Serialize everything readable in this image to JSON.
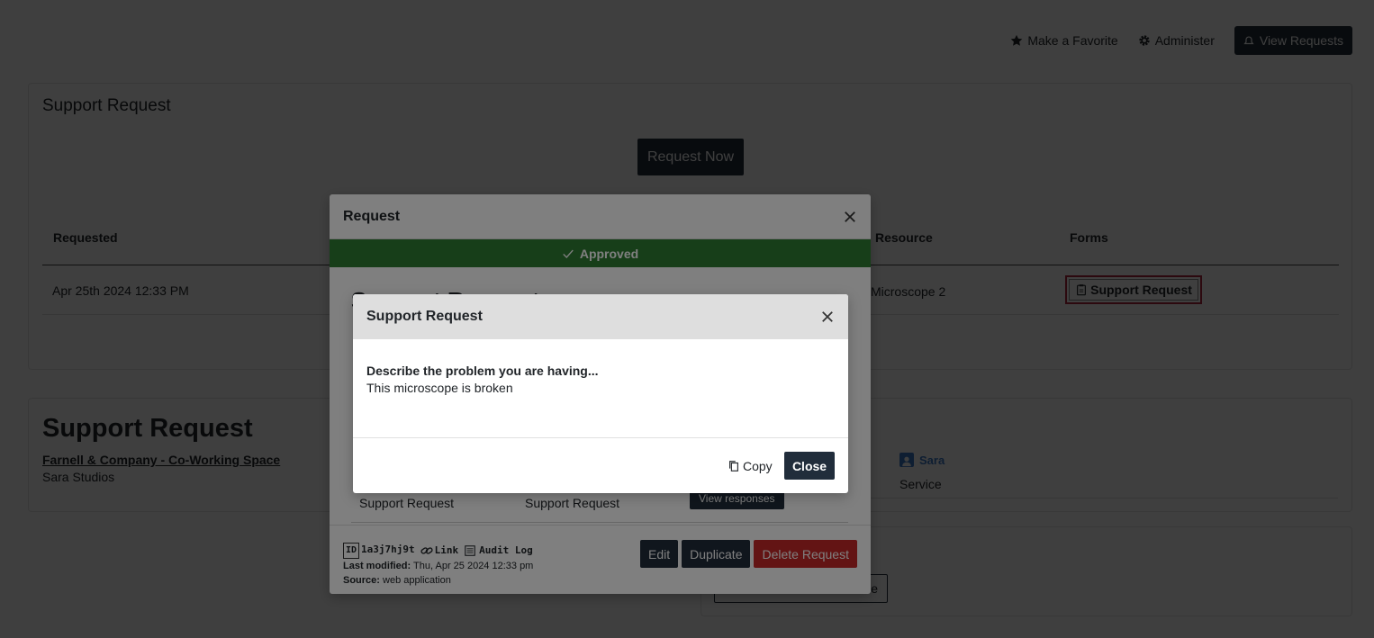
{
  "topnav": {
    "favorite_label": "Make a Favorite",
    "administer_label": "Administer",
    "view_requests_label": "View Requests"
  },
  "support_card": {
    "title": "Support Request",
    "request_now_label": "Request Now",
    "table": {
      "headers": [
        "Requested",
        "Resource",
        "Forms"
      ],
      "row": {
        "requested": "Apr 25th 2024 12:33 PM",
        "resource": "Microscope 2",
        "form_label": "Support Request"
      }
    }
  },
  "detail_card": {
    "title": "Support Request",
    "company": "Farnell & Company - Co-Working Space",
    "studio": "Sara Studios",
    "user": "Sara",
    "service": "Service"
  },
  "lower_card": {
    "button_label_partial": "e"
  },
  "request_modal": {
    "title": "Request",
    "status": "Approved",
    "partial_heading": "Support Request",
    "row": {
      "col1": "Support Request",
      "col2": "Support Request",
      "button": "View responses"
    },
    "footer": {
      "id_badge": "ID",
      "id_value": "1a3j7hj9t",
      "link_label": "Link",
      "audit_label": "Audit Log",
      "last_modified_label": "Last modified:",
      "last_modified_value": "Thu, Apr 25 2024 12:33 pm",
      "source_label": "Source:",
      "source_value": "web application",
      "edit_label": "Edit",
      "duplicate_label": "Duplicate",
      "delete_label": "Delete Request"
    }
  },
  "support_modal": {
    "title": "Support Request",
    "question": "Describe the problem you are having...",
    "answer": "This microscope is broken",
    "copy_label": "Copy",
    "close_label": "Close"
  },
  "colors": {
    "dark_button": "#212d3b",
    "approved_green": "#2e7d32",
    "delete_red": "#c62828",
    "user_blue": "#3a78c9",
    "highlight_border": "#b0243f"
  }
}
